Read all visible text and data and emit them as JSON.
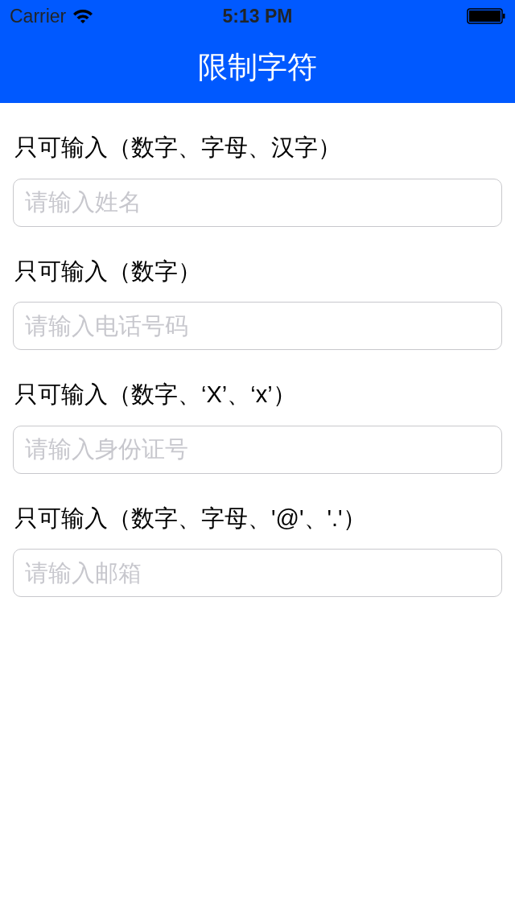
{
  "status_bar": {
    "carrier": "Carrier",
    "time": "5:13 PM"
  },
  "nav_bar": {
    "title": "限制字符"
  },
  "fields": [
    {
      "label": "只可输入（数字、字母、汉字）",
      "placeholder": "请输入姓名"
    },
    {
      "label": "只可输入（数字）",
      "placeholder": "请输入电话号码"
    },
    {
      "label": "只可输入（数字、‘X’、‘x’）",
      "placeholder": "请输入身份证号"
    },
    {
      "label": "只可输入（数字、字母、'@'、'.'）",
      "placeholder": "请输入邮箱"
    }
  ]
}
